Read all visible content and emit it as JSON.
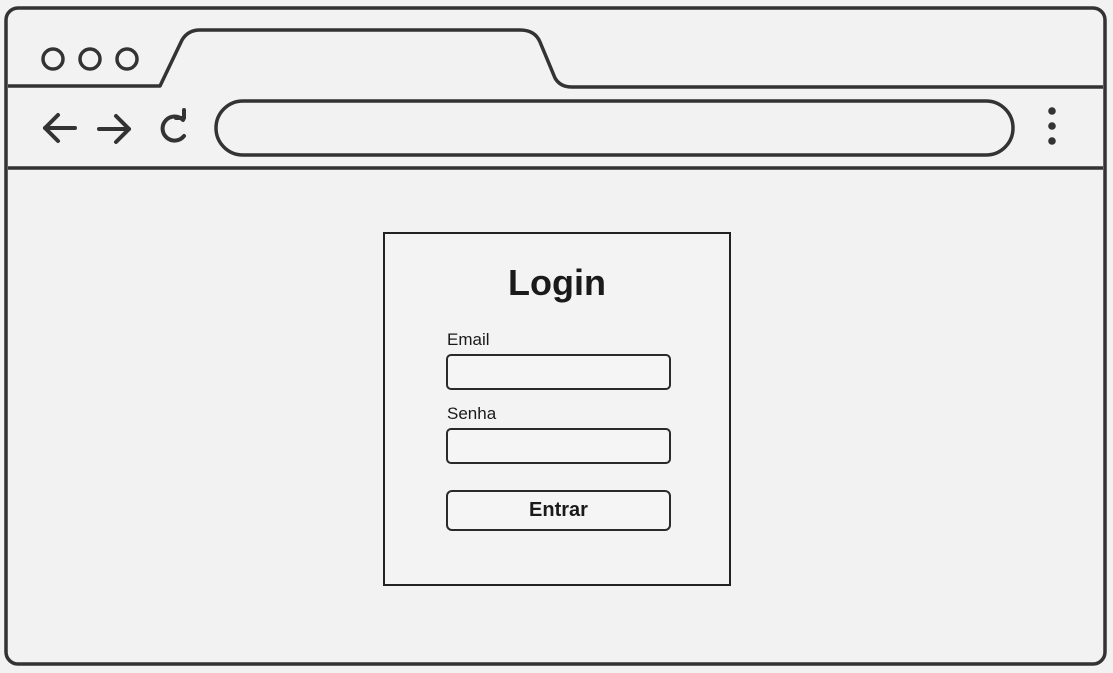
{
  "browser": {
    "nav_icons": [
      "back-arrow-icon",
      "forward-arrow-icon",
      "reload-icon",
      "menu-dots-icon"
    ],
    "window_controls": [
      "window-control-circle",
      "window-control-circle",
      "window-control-circle"
    ],
    "address_bar": {
      "value": "",
      "placeholder": ""
    }
  },
  "login": {
    "title": "Login",
    "email_label": "Email",
    "email_value": "",
    "password_label": "Senha",
    "password_value": "",
    "submit_label": "Entrar"
  },
  "colors": {
    "stroke": "#333333",
    "background": "#f2f2f2"
  }
}
